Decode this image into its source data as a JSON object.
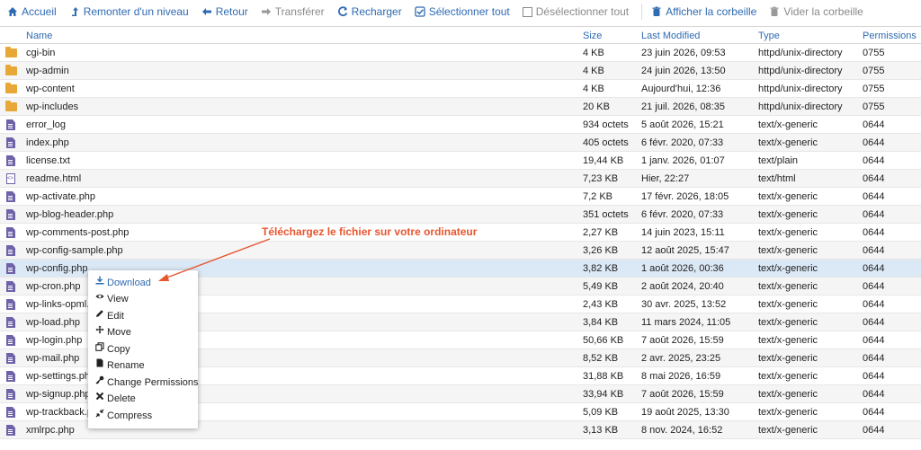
{
  "toolbar": {
    "home": "Accueil",
    "up": "Remonter d'un niveau",
    "back": "Retour",
    "forward": "Transférer",
    "reload": "Recharger",
    "select_all": "Sélectionner tout",
    "deselect_all": "Désélectionner tout",
    "show_trash": "Afficher la corbeille",
    "empty_trash": "Vider la corbeille"
  },
  "table": {
    "columns": {
      "name": "Name",
      "size": "Size",
      "modified": "Last Modified",
      "type": "Type",
      "perms": "Permissions"
    },
    "rows": [
      {
        "icon": "folder-icon",
        "name": "cgi-bin",
        "size": "4 KB",
        "modified": "23 juin 2026, 09:53",
        "type": "httpd/unix-directory",
        "perms": "0755"
      },
      {
        "icon": "folder-icon",
        "name": "wp-admin",
        "size": "4 KB",
        "modified": "24 juin 2026, 13:50",
        "type": "httpd/unix-directory",
        "perms": "0755"
      },
      {
        "icon": "folder-icon",
        "name": "wp-content",
        "size": "4 KB",
        "modified": "Aujourd'hui, 12:36",
        "type": "httpd/unix-directory",
        "perms": "0755"
      },
      {
        "icon": "folder-icon",
        "name": "wp-includes",
        "size": "20 KB",
        "modified": "21 juil. 2026, 08:35",
        "type": "httpd/unix-directory",
        "perms": "0755"
      },
      {
        "icon": "file-icon",
        "name": "error_log",
        "size": "934 octets",
        "modified": "5 août 2026, 15:21",
        "type": "text/x-generic",
        "perms": "0644"
      },
      {
        "icon": "file-icon",
        "name": "index.php",
        "size": "405 octets",
        "modified": "6 févr. 2020, 07:33",
        "type": "text/x-generic",
        "perms": "0644"
      },
      {
        "icon": "file-icon",
        "name": "license.txt",
        "size": "19,44 KB",
        "modified": "1 janv. 2026, 01:07",
        "type": "text/plain",
        "perms": "0644"
      },
      {
        "icon": "html-file-icon",
        "name": "readme.html",
        "size": "7,23 KB",
        "modified": "Hier, 22:27",
        "type": "text/html",
        "perms": "0644"
      },
      {
        "icon": "file-icon",
        "name": "wp-activate.php",
        "size": "7,2 KB",
        "modified": "17 févr. 2026, 18:05",
        "type": "text/x-generic",
        "perms": "0644"
      },
      {
        "icon": "file-icon",
        "name": "wp-blog-header.php",
        "size": "351 octets",
        "modified": "6 févr. 2020, 07:33",
        "type": "text/x-generic",
        "perms": "0644"
      },
      {
        "icon": "file-icon",
        "name": "wp-comments-post.php",
        "size": "2,27 KB",
        "modified": "14 juin 2023, 15:11",
        "type": "text/x-generic",
        "perms": "0644"
      },
      {
        "icon": "file-icon",
        "name": "wp-config-sample.php",
        "size": "3,26 KB",
        "modified": "12 août 2025, 15:47",
        "type": "text/x-generic",
        "perms": "0644"
      },
      {
        "icon": "file-icon",
        "name": "wp-config.php",
        "size": "3,82 KB",
        "modified": "1 août 2026, 00:36",
        "type": "text/x-generic",
        "perms": "0644",
        "selected": true
      },
      {
        "icon": "file-icon",
        "name": "wp-cron.php",
        "size": "5,49 KB",
        "modified": "2 août 2024, 20:40",
        "type": "text/x-generic",
        "perms": "0644"
      },
      {
        "icon": "file-icon",
        "name": "wp-links-opml.php",
        "size": "2,43 KB",
        "modified": "30 avr. 2025, 13:52",
        "type": "text/x-generic",
        "perms": "0644"
      },
      {
        "icon": "file-icon",
        "name": "wp-load.php",
        "size": "3,84 KB",
        "modified": "11 mars 2024, 11:05",
        "type": "text/x-generic",
        "perms": "0644"
      },
      {
        "icon": "file-icon",
        "name": "wp-login.php",
        "size": "50,66 KB",
        "modified": "7 août 2026, 15:59",
        "type": "text/x-generic",
        "perms": "0644"
      },
      {
        "icon": "file-icon",
        "name": "wp-mail.php",
        "size": "8,52 KB",
        "modified": "2 avr. 2025, 23:25",
        "type": "text/x-generic",
        "perms": "0644"
      },
      {
        "icon": "file-icon",
        "name": "wp-settings.php",
        "size": "31,88 KB",
        "modified": "8 mai 2026, 16:59",
        "type": "text/x-generic",
        "perms": "0644"
      },
      {
        "icon": "file-icon",
        "name": "wp-signup.php",
        "size": "33,94 KB",
        "modified": "7 août 2026, 15:59",
        "type": "text/x-generic",
        "perms": "0644"
      },
      {
        "icon": "file-icon",
        "name": "wp-trackback.php",
        "size": "5,09 KB",
        "modified": "19 août 2025, 13:30",
        "type": "text/x-generic",
        "perms": "0644"
      },
      {
        "icon": "file-icon",
        "name": "xmlrpc.php",
        "size": "3,13 KB",
        "modified": "8 nov. 2024, 16:52",
        "type": "text/x-generic",
        "perms": "0644"
      }
    ]
  },
  "context_menu": {
    "items": [
      {
        "label": "Download",
        "icon": "download-icon"
      },
      {
        "label": "View",
        "icon": "eye-icon"
      },
      {
        "label": "Edit",
        "icon": "pencil-icon"
      },
      {
        "label": "Move",
        "icon": "move-icon"
      },
      {
        "label": "Copy",
        "icon": "copy-icon"
      },
      {
        "label": "Rename",
        "icon": "file-icon"
      },
      {
        "label": "Change Permissions",
        "icon": "key-icon"
      },
      {
        "label": "Delete",
        "icon": "delete-icon"
      },
      {
        "label": "Compress",
        "icon": "compress-icon"
      }
    ]
  },
  "annotation": {
    "text": "Téléchargez le fichier sur votre ordinateur",
    "color": "#e8552f"
  },
  "colors": {
    "accent": "#2f6bb3",
    "selected_row": "#dbe8f5",
    "folder": "#e8a838",
    "file": "#6f62a8"
  }
}
